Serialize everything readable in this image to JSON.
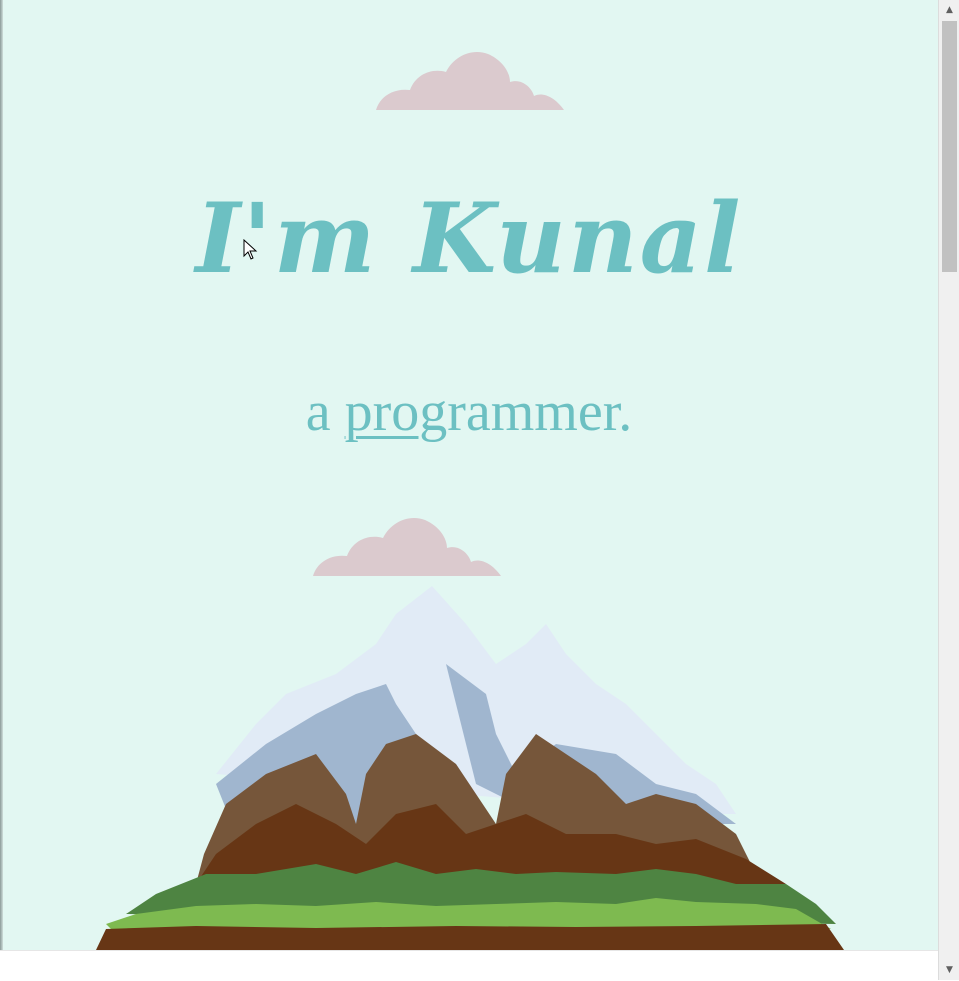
{
  "page": {
    "background_color": "#e2f7f2",
    "accent_color": "#6cc0c2",
    "cloud_color": "#dbcace"
  },
  "hero": {
    "title": "I'm Kunal",
    "subtitle_prefix": "a ",
    "subtitle_typed": "prog",
    "subtitle_rest": "rammer."
  },
  "illustration": {
    "clouds": [
      "cloud-icon",
      "cloud-icon"
    ],
    "mountain": "mountain-icon"
  },
  "scrollbar": {
    "up_arrow": "▲",
    "down_arrow": "▼",
    "scroll_position": 0.0
  }
}
